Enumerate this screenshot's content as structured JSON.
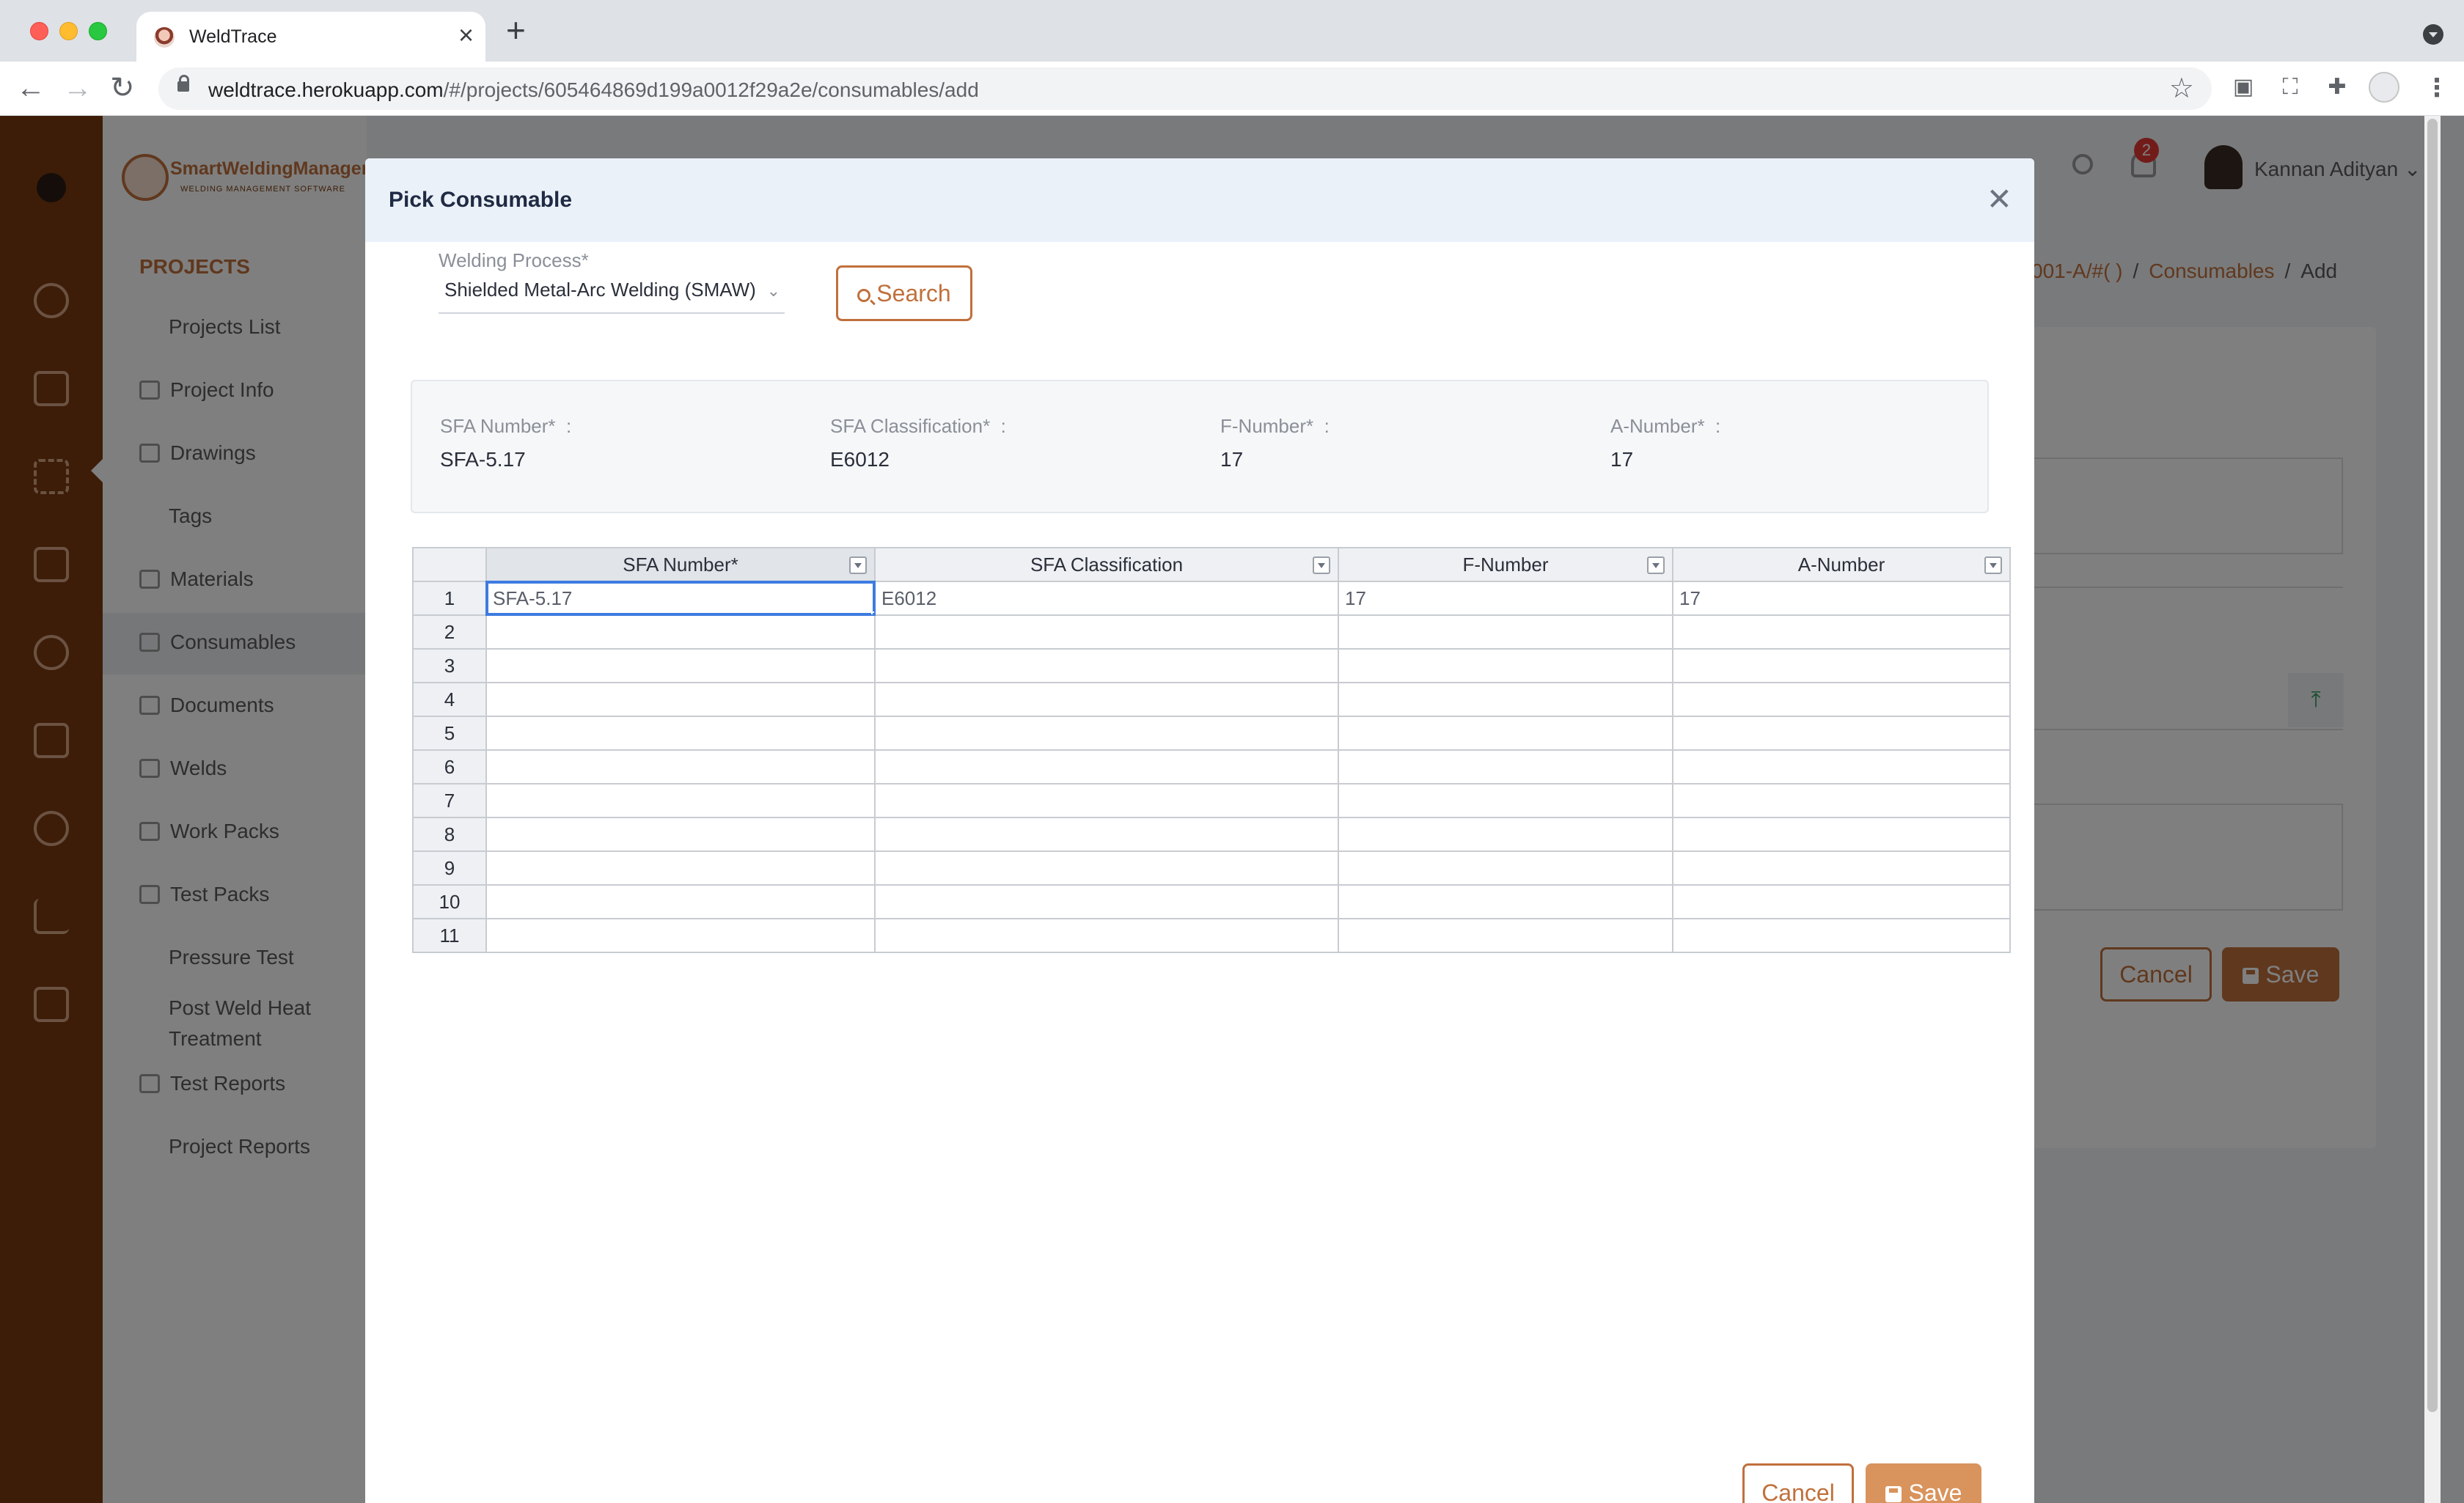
{
  "browser": {
    "tab_title": "WeldTrace",
    "url_host": "weldtrace.herokuapp.com",
    "url_path": "/#/projects/605464869d199a0012f29a2e/consumables/add"
  },
  "app": {
    "logo_title": "SmartWeldingManager",
    "logo_subtitle": "WELDING MANAGEMENT SOFTWARE",
    "sidebar_heading": "PROJECTS",
    "sidebar_items": [
      {
        "label": "Projects List",
        "icon": "none"
      },
      {
        "label": "Project Info",
        "icon": "briefcase-icon"
      },
      {
        "label": "Drawings",
        "icon": "ruler-icon"
      },
      {
        "label": "Tags",
        "icon": "none"
      },
      {
        "label": "Materials",
        "icon": "box-icon"
      },
      {
        "label": "Consumables",
        "icon": "consumables-icon"
      },
      {
        "label": "Documents",
        "icon": "documents-icon"
      },
      {
        "label": "Welds",
        "icon": "wand-icon"
      },
      {
        "label": "Work Packs",
        "icon": "clipboard-icon"
      },
      {
        "label": "Test Packs",
        "icon": "clipboard-icon"
      },
      {
        "label": "Pressure Test",
        "icon": "none"
      },
      {
        "label": "Post Weld Heat Treatment",
        "icon": "none"
      },
      {
        "label": "Test Reports",
        "icon": "copy-icon"
      },
      {
        "label": "Project Reports",
        "icon": "none"
      }
    ],
    "notification_count": "2",
    "user_name": "Kannan Adityan",
    "breadcrumb": {
      "partial": "001-A/#( )",
      "section": "Consumables",
      "current": "Add"
    },
    "bg_cancel": "Cancel",
    "bg_save": "Save"
  },
  "modal": {
    "title": "Pick Consumable",
    "welding_process_label": "Welding Process*",
    "welding_process_value": "Shielded Metal-Arc Welding (SMAW)",
    "search_label": "Search",
    "summary": [
      {
        "label": "SFA Number*",
        "value": "SFA-5.17"
      },
      {
        "label": "SFA Classification*",
        "value": "E6012"
      },
      {
        "label": "F-Number*",
        "value": "17"
      },
      {
        "label": "A-Number*",
        "value": "17"
      }
    ],
    "summary_sep": ":",
    "grid": {
      "columns": [
        "SFA Number*",
        "SFA Classification",
        "F-Number",
        "A-Number"
      ],
      "rows": [
        [
          "1",
          "SFA-5.17",
          "E6012",
          "17",
          "17"
        ],
        [
          "2",
          "",
          "",
          "",
          ""
        ],
        [
          "3",
          "",
          "",
          "",
          ""
        ],
        [
          "4",
          "",
          "",
          "",
          ""
        ],
        [
          "5",
          "",
          "",
          "",
          ""
        ],
        [
          "6",
          "",
          "",
          "",
          ""
        ],
        [
          "7",
          "",
          "",
          "",
          ""
        ],
        [
          "8",
          "",
          "",
          "",
          ""
        ],
        [
          "9",
          "",
          "",
          "",
          ""
        ],
        [
          "10",
          "",
          "",
          "",
          ""
        ],
        [
          "11",
          "",
          "",
          "",
          ""
        ]
      ]
    },
    "cancel_label": "Cancel",
    "save_label": "Save"
  },
  "colors": {
    "accent": "#c0703c",
    "rail": "#7a3b10",
    "selection": "#3d7be0"
  }
}
